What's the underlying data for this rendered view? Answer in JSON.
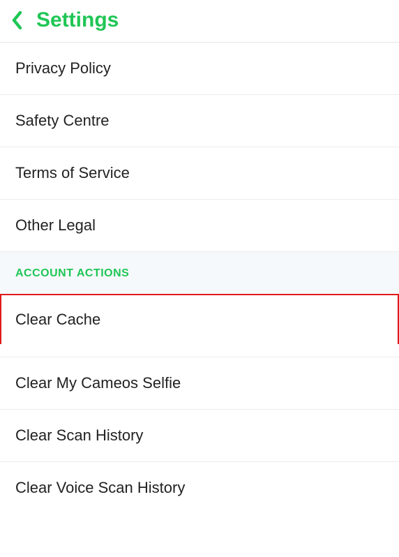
{
  "header": {
    "title": "Settings"
  },
  "legal_items": [
    {
      "label": "Privacy Policy"
    },
    {
      "label": "Safety Centre"
    },
    {
      "label": "Terms of Service"
    },
    {
      "label": "Other Legal"
    }
  ],
  "section_header": "ACCOUNT ACTIONS",
  "account_items": [
    {
      "label": "Clear Cache",
      "highlighted": true
    },
    {
      "label": "Clear My Cameos Selfie"
    },
    {
      "label": "Clear Scan History"
    },
    {
      "label": "Clear Voice Scan History"
    }
  ]
}
